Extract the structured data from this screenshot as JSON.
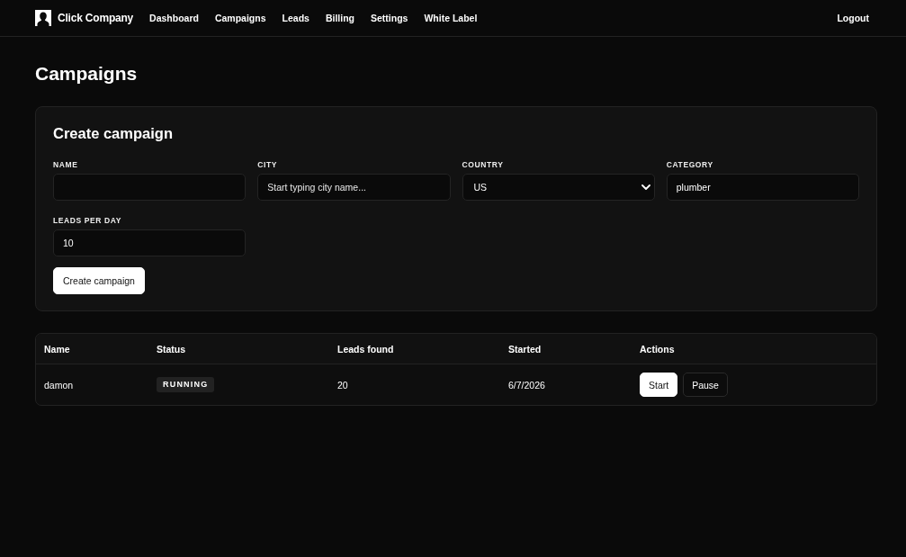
{
  "nav": {
    "brand": "Click Company",
    "links": [
      "Dashboard",
      "Campaigns",
      "Leads",
      "Billing",
      "Settings",
      "White Label"
    ],
    "logout": "Logout"
  },
  "page_title": "Campaigns",
  "create_form": {
    "title": "Create campaign",
    "fields": [
      {
        "kind": "text",
        "label": "NAME"
      },
      {
        "kind": "text",
        "label": "CITY",
        "placeholder": "Start typing city name..."
      },
      {
        "kind": "select",
        "label": "COUNTRY",
        "value": "US"
      },
      {
        "kind": "text",
        "label": "CATEGORY",
        "value": "plumber"
      },
      {
        "kind": "text",
        "label": "LEADS PER DAY",
        "value": "10"
      }
    ],
    "submit": "Create campaign"
  },
  "table": {
    "columns": [
      "Name",
      "Status",
      "Leads found",
      "Started",
      "Actions"
    ],
    "rows": [
      {
        "name": "damon",
        "status": "RUNNING",
        "leads_found": "20",
        "started": "6/7/2026",
        "actions": [
          {
            "label": "Start",
            "kind": "primary"
          },
          {
            "label": "Pause",
            "kind": "secondary"
          }
        ]
      }
    ]
  }
}
